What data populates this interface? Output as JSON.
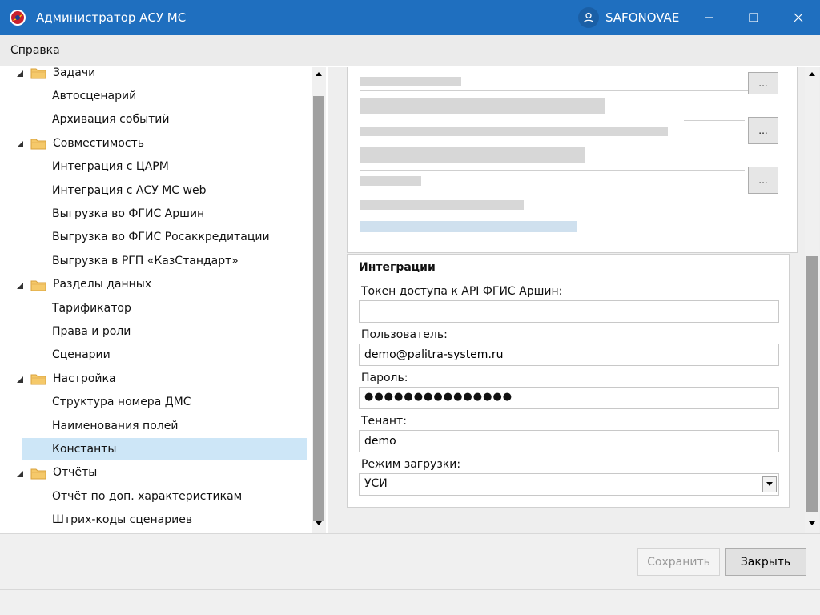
{
  "window": {
    "title": "Администратор АСУ МС",
    "user": "SAFONOVAE",
    "accent_color": "#1f6fbf"
  },
  "menu": {
    "help": "Справка"
  },
  "tree": {
    "rows": [
      {
        "type": "group",
        "label": "Задачи"
      },
      {
        "type": "leaf",
        "label": "Автосценарий"
      },
      {
        "type": "leaf",
        "label": "Архивация событий"
      },
      {
        "type": "group",
        "label": "Совместимость"
      },
      {
        "type": "leaf",
        "label": "Интеграция с ЦАРМ"
      },
      {
        "type": "leaf",
        "label": "Интеграция с АСУ МС web"
      },
      {
        "type": "leaf",
        "label": "Выгрузка во ФГИС Аршин"
      },
      {
        "type": "leaf",
        "label": "Выгрузка во ФГИС Росаккредитации"
      },
      {
        "type": "leaf",
        "label": "Выгрузка в РГП «КазСтандарт»"
      },
      {
        "type": "group",
        "label": "Разделы данных"
      },
      {
        "type": "leaf",
        "label": "Тарификатор"
      },
      {
        "type": "leaf",
        "label": "Права и роли"
      },
      {
        "type": "leaf",
        "label": "Сценарии"
      },
      {
        "type": "group",
        "label": "Настройка"
      },
      {
        "type": "leaf",
        "label": "Структура номера ДМС"
      },
      {
        "type": "leaf",
        "label": "Наименования полей"
      },
      {
        "type": "leaf",
        "label": "Константы",
        "selected": true
      },
      {
        "type": "group",
        "label": "Отчёты"
      },
      {
        "type": "leaf",
        "label": "Отчёт по доп. характеристикам"
      },
      {
        "type": "leaf",
        "label": "Штрих-коды сценариев"
      }
    ],
    "selected_color": "#cde6f7"
  },
  "top_panel": {
    "browse_label": "..."
  },
  "integrations": {
    "heading": "Интеграции",
    "token_label": "Токен доступа к API ФГИС Аршин:",
    "token_value": "",
    "user_label": "Пользователь:",
    "user_value": "demo@palitra-system.ru",
    "password_label": "Пароль:",
    "password_value": "●●●●●●●●●●●●●●●",
    "tenant_label": "Тенант:",
    "tenant_value": "demo",
    "mode_label": "Режим загрузки:",
    "mode_value": "УСИ"
  },
  "buttons": {
    "save": "Сохранить",
    "close": "Закрыть"
  }
}
